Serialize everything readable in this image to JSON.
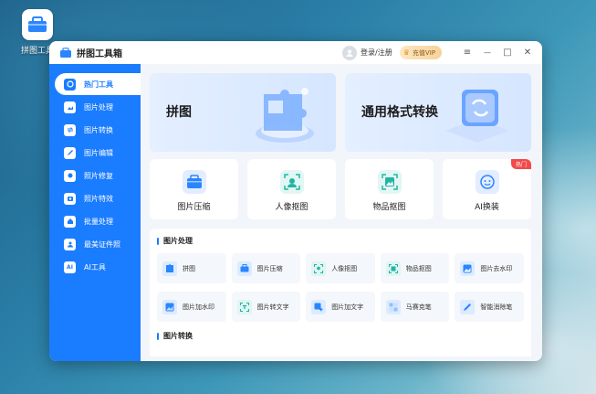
{
  "desktop": {
    "icon_label": "拼图工具"
  },
  "window": {
    "title": "拼图工具箱",
    "login_label": "登录/注册",
    "vip_label": "充值VIP",
    "menu_glyph": "≡",
    "minimize_glyph": "—",
    "maximize_glyph": "□",
    "close_glyph": "✕"
  },
  "sidebar": {
    "items": [
      {
        "label": "热门工具",
        "icon": "hot-tools-icon"
      },
      {
        "label": "图片处理",
        "icon": "image-process-icon"
      },
      {
        "label": "图片转换",
        "icon": "image-convert-icon"
      },
      {
        "label": "图片编辑",
        "icon": "image-edit-icon"
      },
      {
        "label": "照片修复",
        "icon": "photo-repair-icon"
      },
      {
        "label": "照片特效",
        "icon": "photo-effect-icon"
      },
      {
        "label": "批量处理",
        "icon": "batch-icon"
      },
      {
        "label": "最美证件照",
        "icon": "id-photo-icon"
      },
      {
        "label": "AI工具",
        "icon": "ai-icon"
      }
    ]
  },
  "banners": [
    {
      "label": "拼图"
    },
    {
      "label": "通用格式转换"
    }
  ],
  "tools": [
    {
      "label": "图片压缩"
    },
    {
      "label": "人像抠图"
    },
    {
      "label": "物品抠图"
    },
    {
      "label": "AI换装",
      "badge": "热门"
    }
  ],
  "section1": {
    "title": "图片处理",
    "items": [
      {
        "label": "拼图"
      },
      {
        "label": "图片压缩"
      },
      {
        "label": "人像抠图"
      },
      {
        "label": "物品抠图"
      },
      {
        "label": "图片去水印"
      },
      {
        "label": "图片加水印"
      },
      {
        "label": "图片转文字"
      },
      {
        "label": "图片加文字"
      },
      {
        "label": "马赛克笔"
      },
      {
        "label": "智能消除笔"
      }
    ]
  },
  "section2": {
    "title": "图片转换"
  },
  "colors": {
    "primary": "#1a7cff",
    "hot": "#f24a4a",
    "vip": "#f7d29a"
  }
}
